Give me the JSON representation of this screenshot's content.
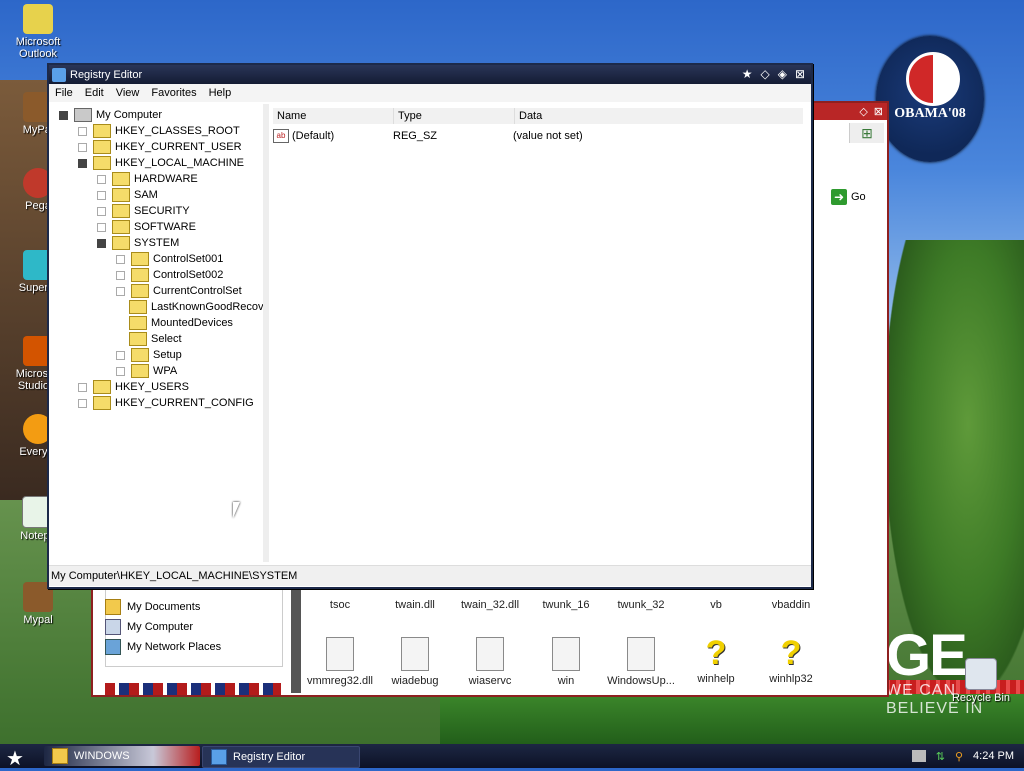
{
  "desktop": {
    "icons": [
      "Microsoft Outlook",
      "MyPal",
      "Pega",
      "Superm",
      "Microsoft Studio 2",
      "Everyth",
      "Notepa",
      "Mypal"
    ],
    "recycle_bin": "Recycle Bin",
    "wallpaper": {
      "badge": "OBAMA'08",
      "slogan_fragment": "GE",
      "tagline_fragment": "WE CAN BELIEVE IN"
    }
  },
  "background_window": {
    "go_label": "Go",
    "left_pane_items": [
      "My Documents",
      "My Computer",
      "My Network Places"
    ],
    "files": [
      "tsoc",
      "twain.dll",
      "twain_32.dll",
      "twunk_16",
      "twunk_32",
      "vb",
      "vbaddin",
      "vmmreg32.dll",
      "wiadebug",
      "wiaservc",
      "win",
      "WindowsUp...",
      "winhelp",
      "winhlp32"
    ]
  },
  "registry_editor": {
    "title": "Registry Editor",
    "menu": [
      "File",
      "Edit",
      "View",
      "Favorites",
      "Help"
    ],
    "tree": {
      "root": "My Computer",
      "hives": [
        "HKEY_CLASSES_ROOT",
        "HKEY_CURRENT_USER",
        "HKEY_LOCAL_MACHINE"
      ],
      "hklm_children": [
        "HARDWARE",
        "SAM",
        "SECURITY",
        "SOFTWARE",
        "SYSTEM"
      ],
      "system_children": [
        "ControlSet001",
        "ControlSet002",
        "CurrentControlSet",
        "LastKnownGoodRecove",
        "MountedDevices",
        "Select",
        "Setup",
        "WPA"
      ],
      "other_hives": [
        "HKEY_USERS",
        "HKEY_CURRENT_CONFIG"
      ],
      "selected": "SYSTEM"
    },
    "columns": [
      "Name",
      "Type",
      "Data"
    ],
    "values": [
      {
        "name": "(Default)",
        "type": "REG_SZ",
        "data": "(value not set)"
      }
    ],
    "status_path": "My Computer\\HKEY_LOCAL_MACHINE\\SYSTEM"
  },
  "taskbar": {
    "buttons": [
      "WINDOWS",
      "Registry Editor"
    ],
    "clock": "4:24 PM"
  },
  "colors": {
    "title_bar": "#1d2a4a",
    "bg_window_border": "#b92626",
    "taskbar": "#141c33"
  }
}
